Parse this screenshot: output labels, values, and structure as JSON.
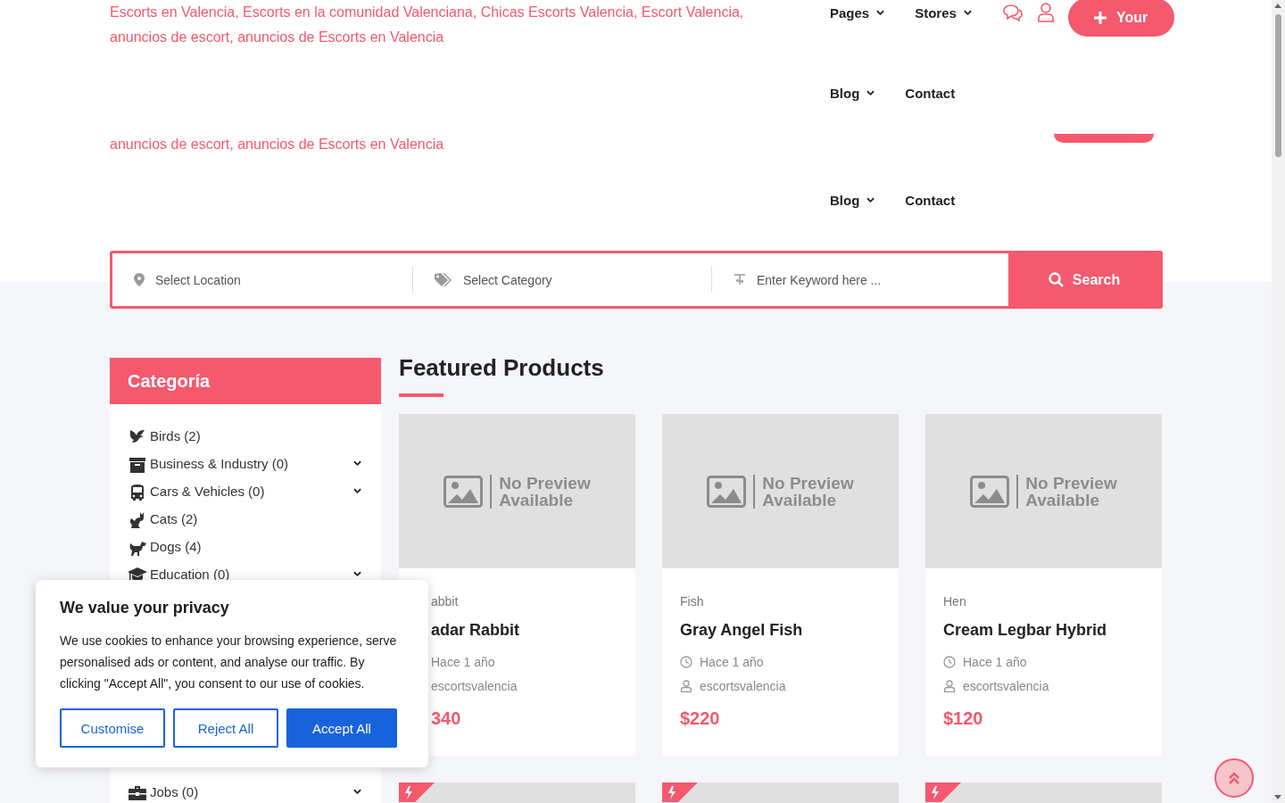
{
  "header": {
    "site_title_lines": [
      "Escorts en Valencia, Escorts en la comunidad Valenciana, Chicas Escorts Valencia, Escort Valencia,",
      "anuncios de escort, anuncios de Escorts en Valencia"
    ],
    "repeated_title_line": "anuncios de escort, anuncios de Escorts en Valencia",
    "nav_row_1": [
      {
        "label": "Pages",
        "dropdown": true
      },
      {
        "label": "Stores",
        "dropdown": true
      }
    ],
    "post_button": "Your",
    "nav_row_2": [
      {
        "label": "Blog",
        "dropdown": true
      },
      {
        "label": "Contact",
        "dropdown": false
      }
    ],
    "nav_row_3": [
      {
        "label": "Blog",
        "dropdown": true
      },
      {
        "label": "Contact",
        "dropdown": false
      }
    ]
  },
  "search": {
    "location_placeholder": "Select Location",
    "category_placeholder": "Select Category",
    "keyword_placeholder": "Enter Keyword here ...",
    "button": "Search"
  },
  "sidebar": {
    "title": "Categoría",
    "items": [
      {
        "label": "Birds (2)",
        "kind": "bird",
        "expandable": false
      },
      {
        "label": "Business & Industry (0)",
        "kind": "box",
        "expandable": true
      },
      {
        "label": "Cars & Vehicles (0)",
        "kind": "bus",
        "expandable": true
      },
      {
        "label": "Cats (2)",
        "kind": "cat",
        "expandable": false
      },
      {
        "label": "Dogs (4)",
        "kind": "dog",
        "expandable": false
      },
      {
        "label": "Education (0)",
        "kind": "cap",
        "expandable": true
      }
    ],
    "lower_items": [
      {
        "label": "Jobs (0)",
        "kind": "briefcase",
        "expandable": true
      }
    ]
  },
  "featured": {
    "title": "Featured Products",
    "products": [
      {
        "image_label_lines": [
          "No Preview",
          "Available"
        ],
        "category": "abbit",
        "title": "adar Rabbit",
        "time": "Hace 1 año",
        "author": "escortsvalencia",
        "price": "340",
        "partly_covered": true
      },
      {
        "image_label_lines": [
          "No Preview",
          "Available"
        ],
        "category": "Fish",
        "title": "Gray Angel Fish",
        "time": "Hace 1 año",
        "author": "escortsvalencia",
        "price": "$220",
        "partly_covered": false
      },
      {
        "image_label_lines": [
          "No Preview",
          "Available"
        ],
        "category": "Hen",
        "title": "Cream Legbar Hybrid",
        "time": "Hace 1 año",
        "author": "escortsvalencia",
        "price": "$120",
        "partly_covered": false
      }
    ],
    "next_row": [
      {
        "featured": true
      },
      {
        "featured": true
      },
      {
        "featured": true
      }
    ]
  },
  "cookie_banner": {
    "title": "We value your privacy",
    "text": "We use cookies to enhance your browsing experience, serve personalised ads or content, and analyse our traffic. By clicking \"Accept All\", you consent to our use of cookies.",
    "buttons": [
      {
        "label": "Customise",
        "kind": "outline"
      },
      {
        "label": "Reject All",
        "kind": "outline"
      },
      {
        "label": "Accept All",
        "kind": "primary"
      }
    ]
  }
}
